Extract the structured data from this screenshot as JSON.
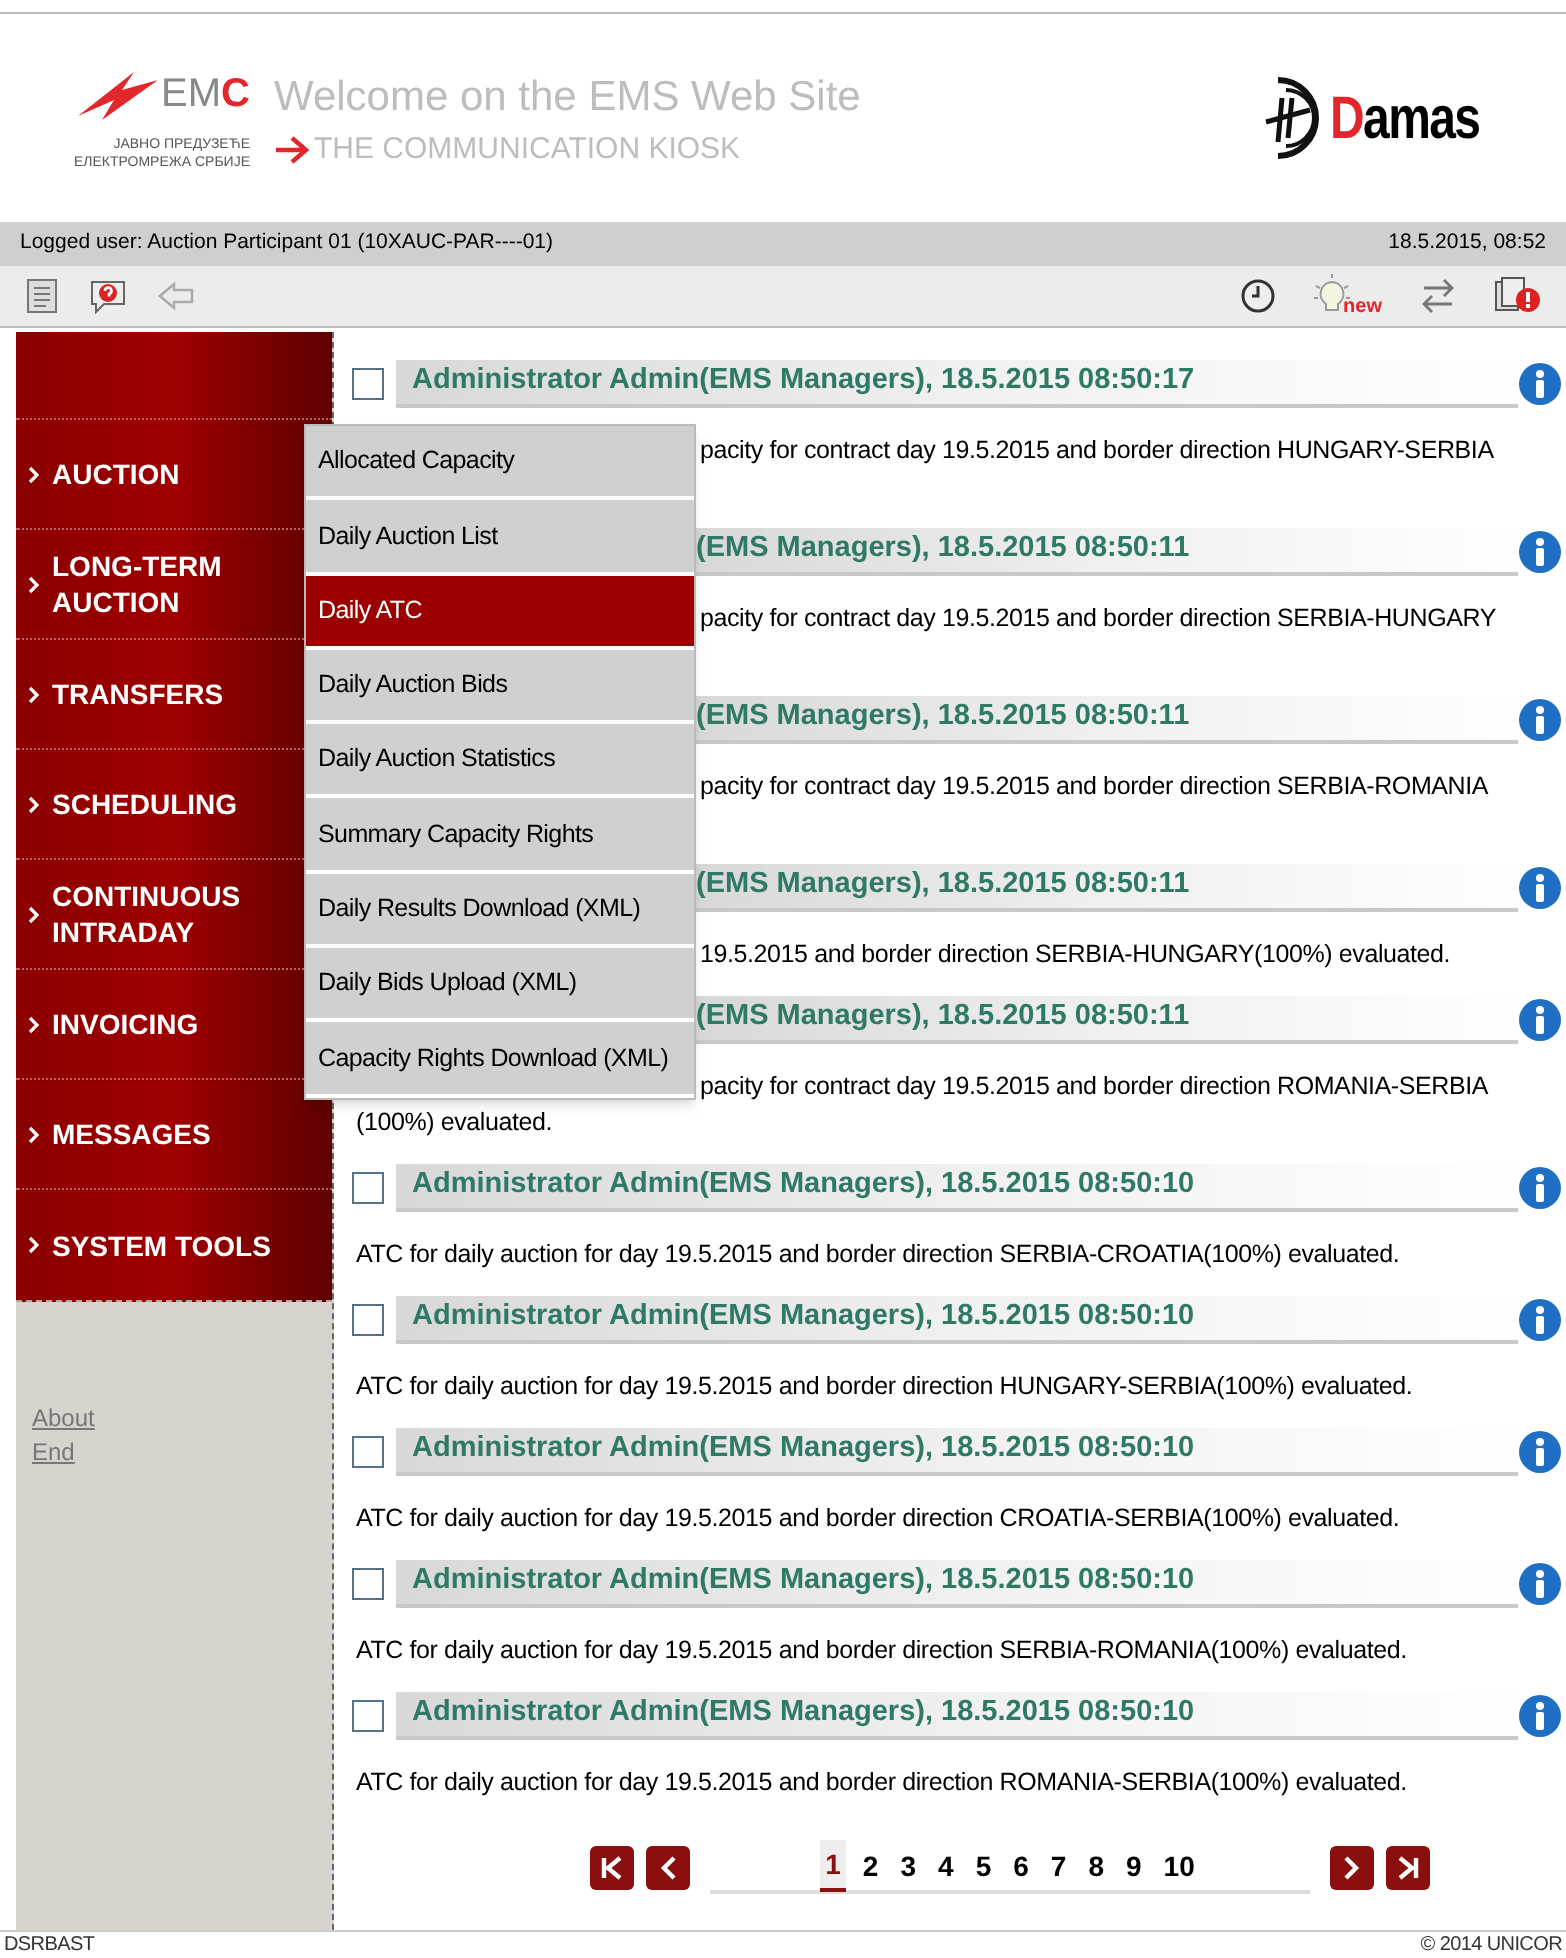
{
  "header": {
    "emc_logo": {
      "main": "EM",
      "accent": "C",
      "line_1": "ЈАВНО ПРЕДУЗЕЋЕ",
      "line_2": "ЕЛЕКТРОМРЕЖА СРБИЈЕ"
    },
    "title": "Welcome on the EMS Web Site",
    "subtitle": "THE COMMUNICATION KIOSK",
    "damas_logo": {
      "accent": "D",
      "main": "amas"
    }
  },
  "user_bar": {
    "user": "Logged user: Auction Participant 01 (10XAUC-PAR----01)",
    "datetime": "18.5.2015, 08:52"
  },
  "toolbar": {
    "new_label": "new"
  },
  "sidebar": {
    "items": [
      {
        "lines": [
          "AUCTION"
        ]
      },
      {
        "lines": [
          "LONG-TERM",
          "AUCTION"
        ]
      },
      {
        "lines": [
          "TRANSFERS"
        ]
      },
      {
        "lines": [
          "SCHEDULING"
        ]
      },
      {
        "lines": [
          "CONTINUOUS",
          "INTRADAY"
        ]
      },
      {
        "lines": [
          "INVOICING"
        ]
      },
      {
        "lines": [
          "MESSAGES"
        ]
      },
      {
        "lines": [
          "SYSTEM TOOLS"
        ]
      }
    ],
    "links": [
      "About",
      "End"
    ]
  },
  "submenu": {
    "items": [
      {
        "label": "Allocated Capacity",
        "selected": false
      },
      {
        "label": "Daily Auction List",
        "selected": false
      },
      {
        "label": "Daily ATC",
        "selected": true
      },
      {
        "label": "Daily Auction Bids",
        "selected": false
      },
      {
        "label": "Daily Auction Statistics",
        "selected": false
      },
      {
        "label": "Summary Capacity Rights",
        "selected": false
      },
      {
        "label": "Daily Results Download (XML)",
        "selected": false
      },
      {
        "label": "Daily Bids Upload (XML)",
        "selected": false
      },
      {
        "label": "Capacity Rights Download (XML)",
        "selected": false
      }
    ]
  },
  "messages": [
    {
      "checked": false,
      "header_cut": false,
      "header": "Administrator Admin(EMS Managers), 18.5.2015 08:50:17",
      "body_cut": true,
      "wrapped": true,
      "body": [
        "pacity for contract day 19.5.2015 and border direction HUNGARY-SERBIA"
      ]
    },
    {
      "header_cut": true,
      "header": "(EMS Managers), 18.5.2015 08:50:11",
      "body_cut": true,
      "wrapped": true,
      "body": [
        "pacity for contract day 19.5.2015 and border direction SERBIA-HUNGARY"
      ]
    },
    {
      "header_cut": true,
      "header": "(EMS Managers), 18.5.2015 08:50:11",
      "body_cut": true,
      "wrapped": true,
      "body": [
        "pacity for contract day 19.5.2015 and border direction SERBIA-ROMANIA"
      ]
    },
    {
      "header_cut": true,
      "header": "(EMS Managers), 18.5.2015 08:50:11",
      "body_cut": true,
      "wrapped": false,
      "body": [
        "19.5.2015 and border direction SERBIA-HUNGARY(100%) evaluated."
      ]
    },
    {
      "header_cut": true,
      "header": "(EMS Managers), 18.5.2015 08:50:11",
      "body_cut": true,
      "wrapped": false,
      "body": [
        "pacity for contract day 19.5.2015 and border direction ROMANIA-SERBIA",
        "(100%) evaluated."
      ]
    },
    {
      "checked": false,
      "header_cut": false,
      "header": "Administrator Admin(EMS Managers), 18.5.2015 08:50:10",
      "body_cut": false,
      "wrapped": false,
      "body": [
        "ATC for daily auction for day 19.5.2015 and border direction SERBIA-CROATIA(100%) evaluated."
      ]
    },
    {
      "checked": false,
      "header_cut": false,
      "header": "Administrator Admin(EMS Managers), 18.5.2015 08:50:10",
      "body_cut": false,
      "wrapped": false,
      "body": [
        "ATC for daily auction for day 19.5.2015 and border direction HUNGARY-SERBIA(100%) evaluated."
      ]
    },
    {
      "checked": false,
      "header_cut": false,
      "header": "Administrator Admin(EMS Managers), 18.5.2015 08:50:10",
      "body_cut": false,
      "wrapped": false,
      "body": [
        "ATC for daily auction for day 19.5.2015 and border direction CROATIA-SERBIA(100%) evaluated."
      ]
    },
    {
      "checked": false,
      "header_cut": false,
      "header": "Administrator Admin(EMS Managers), 18.5.2015 08:50:10",
      "body_cut": false,
      "wrapped": false,
      "body": [
        "ATC for daily auction for day 19.5.2015 and border direction SERBIA-ROMANIA(100%) evaluated."
      ]
    },
    {
      "checked": false,
      "header_cut": false,
      "header": "Administrator Admin(EMS Managers), 18.5.2015 08:50:10",
      "body_cut": false,
      "wrapped": false,
      "body": [
        "ATC for daily auction for day 19.5.2015 and border direction ROMANIA-SERBIA(100%) evaluated."
      ]
    }
  ],
  "pagination": {
    "pages": [
      {
        "label": "1",
        "selected": true
      },
      {
        "label": "2",
        "selected": false
      },
      {
        "label": "3",
        "selected": false
      },
      {
        "label": "4",
        "selected": false
      },
      {
        "label": "5",
        "selected": false
      },
      {
        "label": "6",
        "selected": false
      },
      {
        "label": "7",
        "selected": false
      },
      {
        "label": "8",
        "selected": false
      },
      {
        "label": "9",
        "selected": false
      },
      {
        "label": "10",
        "selected": false
      }
    ]
  },
  "footer": {
    "left": "DSRBAST",
    "right": "© 2014 UNICOR"
  }
}
